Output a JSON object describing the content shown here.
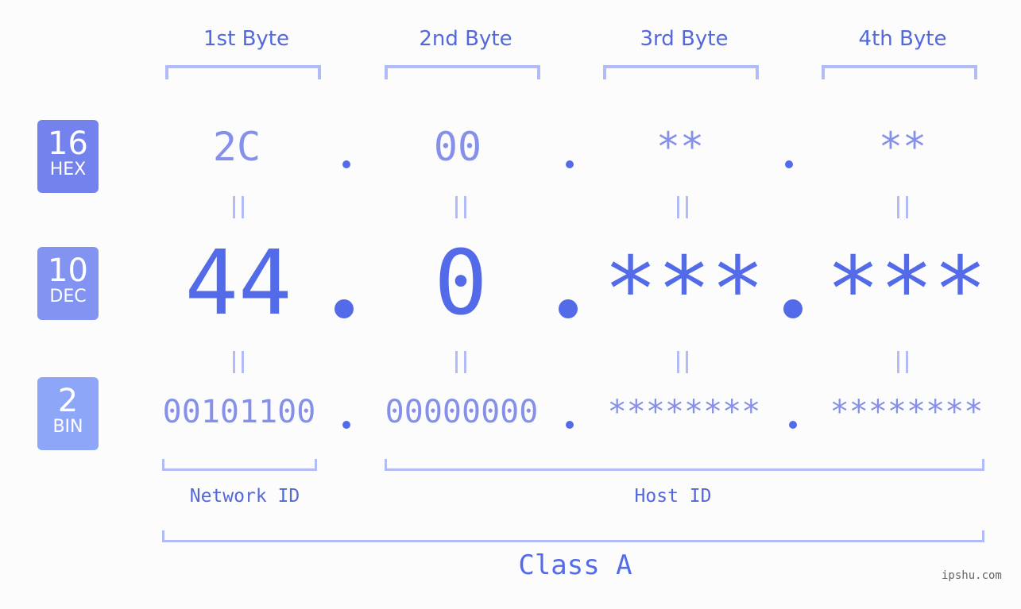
{
  "bytes": {
    "headers": [
      "1st Byte",
      "2nd Byte",
      "3rd Byte",
      "4th Byte"
    ]
  },
  "rows": {
    "hex": {
      "base": "16",
      "label": "HEX",
      "values": [
        "2C",
        "00",
        "**",
        "**"
      ],
      "color": "#7382ec"
    },
    "dec": {
      "base": "10",
      "label": "DEC",
      "values": [
        "44",
        "0",
        "***",
        "***"
      ],
      "color": "#8393f1"
    },
    "bin": {
      "base": "2",
      "label": "BIN",
      "values": [
        "00101100",
        "00000000",
        "********",
        "********"
      ],
      "color": "#8da6f7"
    }
  },
  "segments": {
    "network": "Network ID",
    "host": "Host ID",
    "class": "Class A"
  },
  "watermark": "ipshu.com",
  "colors": {
    "accent": "#546be9",
    "light": "#8590ea",
    "bracket": "#b1bbf6"
  }
}
